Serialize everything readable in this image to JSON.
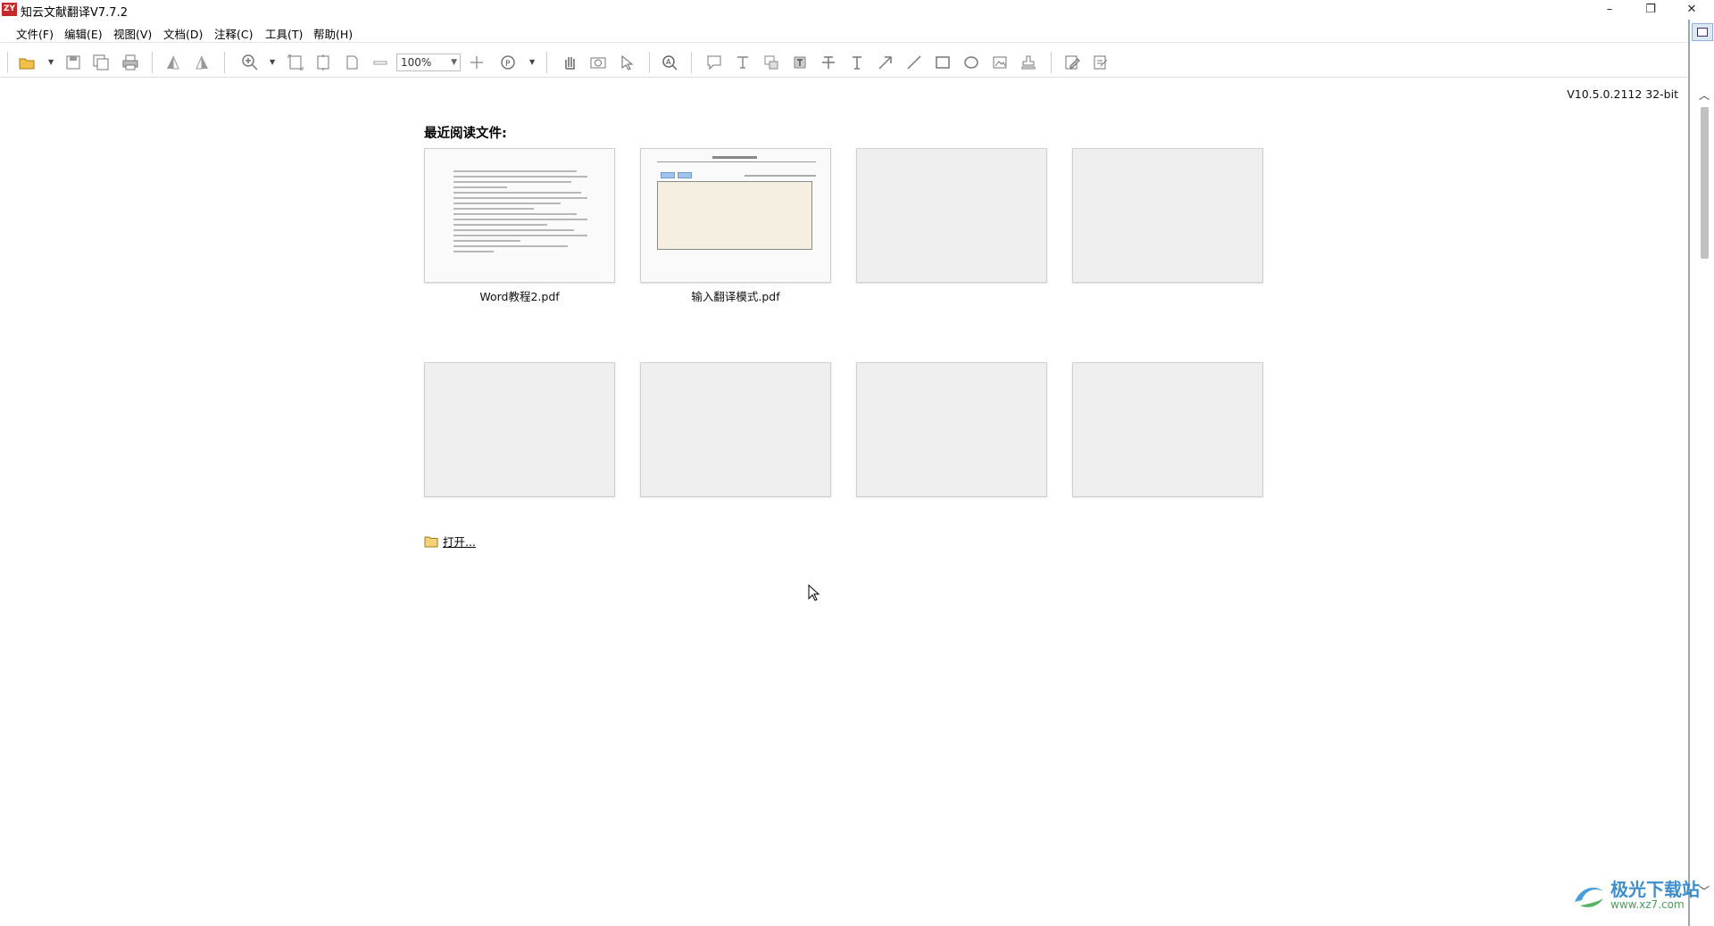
{
  "app": {
    "title": "知云文献翻译V7.7.2",
    "icon_text": "ZY",
    "window_controls": {
      "minimize": "–",
      "restore": "❐",
      "close": "✕"
    }
  },
  "menu": [
    {
      "label": "文件(F)"
    },
    {
      "label": "编辑(E)"
    },
    {
      "label": "视图(V)"
    },
    {
      "label": "文档(D)"
    },
    {
      "label": "注释(C)"
    },
    {
      "label": "工具(T)"
    },
    {
      "label": "帮助(H)"
    }
  ],
  "toolbar": {
    "zoom_value": "100%",
    "icons": [
      "open-icon",
      "save-icon",
      "save-as-icon",
      "print-icon",
      "rotate-left-icon",
      "rotate-right-icon",
      "zoom-in-icon",
      "fit-page-icon",
      "fit-width-icon",
      "fit-visible-icon",
      "zoom-out-minus-icon",
      "zoom-plus-icon",
      "page-icon",
      "hand-icon",
      "snapshot-icon",
      "select-icon",
      "find-icon",
      "note-icon",
      "text-select-icon",
      "highlight-icon",
      "typewriter-icon",
      "strikeout-icon",
      "text-icon",
      "arrow-icon",
      "line-icon",
      "rectangle-icon",
      "ellipse-icon",
      "image-icon",
      "stamp-icon",
      "edit-icon",
      "sign-icon"
    ]
  },
  "main": {
    "version": "V10.5.0.2112 32-bit",
    "recent_title": "最近阅读文件:",
    "recent_files": [
      {
        "name": "Word教程2.pdf",
        "preview": "text"
      },
      {
        "name": "输入翻译模式.pdf",
        "preview": "app"
      },
      {
        "name": "",
        "preview": "empty"
      },
      {
        "name": "",
        "preview": "empty"
      },
      {
        "name": "",
        "preview": "empty"
      },
      {
        "name": "",
        "preview": "empty"
      },
      {
        "name": "",
        "preview": "empty"
      },
      {
        "name": "",
        "preview": "empty"
      }
    ],
    "open_label": "打开..."
  },
  "watermark": {
    "name": "极光下载站",
    "url": "www.xz7.com"
  }
}
